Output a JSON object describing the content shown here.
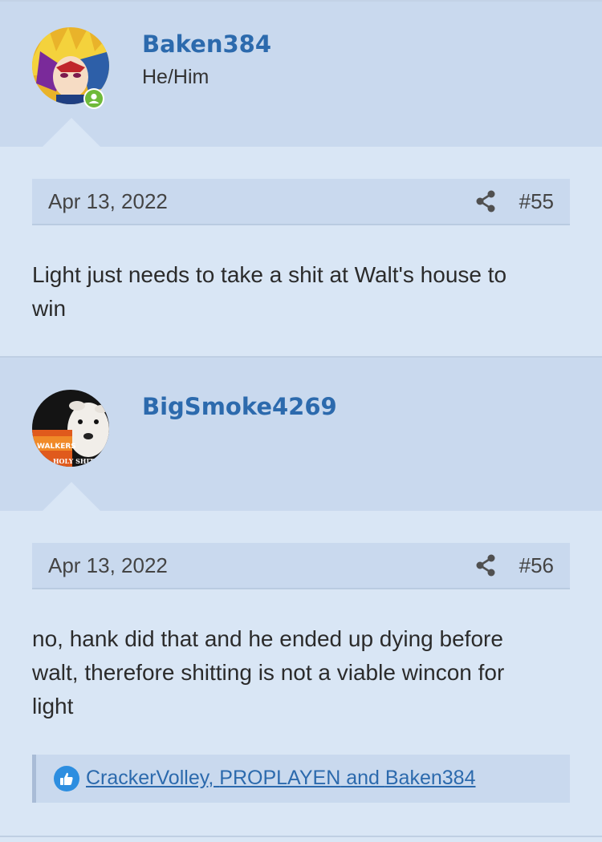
{
  "posts": [
    {
      "username": "Baken384",
      "user_title": "He/Him",
      "avatar": "yugi-avatar",
      "date": "Apr 13, 2022",
      "post_number": "#55",
      "body": [
        "Light just needs to take a shit at Walt's house to",
        "win"
      ]
    },
    {
      "username": "BigSmoke4269",
      "user_title": "",
      "avatar": "dog-walkers-avatar",
      "avatar_text": [
        "WALKERS",
        "HOLY SHIT"
      ],
      "date": "Apr 13, 2022",
      "post_number": "#56",
      "body": [
        "no, hank did that and he ended up dying before",
        "walt, therefore shitting is not a viable wincon for",
        "light"
      ],
      "reactions": {
        "users": [
          "CrackerVolley",
          "PROPLAYEN",
          "Baken384"
        ],
        "sep1": ", ",
        "sep2": " and "
      }
    }
  ],
  "icons": {
    "share": "share-icon",
    "like": "thumbs-up-icon",
    "online": "online-user-icon"
  },
  "colors": {
    "link": "#2c6aad",
    "like": "#2d8ee0",
    "online": "#6fba3a"
  }
}
